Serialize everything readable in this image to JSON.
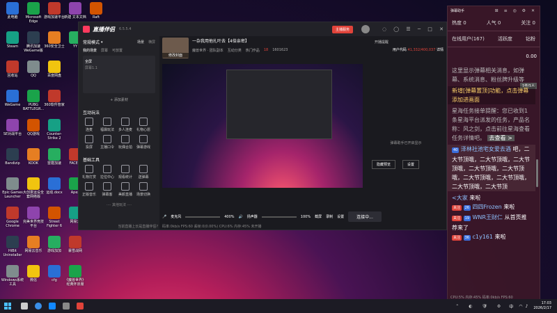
{
  "desktop": {
    "icons": [
      {
        "label": "此电脑"
      },
      {
        "label": "Microsoft Edge"
      },
      {
        "label": "游戏加速平台"
      },
      {
        "label": "新建 文本文档"
      },
      {
        "label": "Raft"
      },
      {
        "label": "Steam"
      },
      {
        "label": "腾讯加速 WeGame版"
      },
      {
        "label": "360安全卫士"
      },
      {
        "label": "YY"
      },
      {
        "label": "回收站"
      },
      {
        "label": "QQ"
      },
      {
        "label": "百度网盘"
      },
      {
        "label": "WeGame"
      },
      {
        "label": "PUBG BATTLEGR..."
      },
      {
        "label": "360软件管家"
      },
      {
        "label": "SE对战平台"
      },
      {
        "label": "QQ游戏"
      },
      {
        "label": "Counter-Strike 2"
      },
      {
        "label": "Bandizip"
      },
      {
        "label": "KOOK"
      },
      {
        "label": "雷霆加速"
      },
      {
        "label": "FACEIT"
      },
      {
        "label": "Epic Games Launcher"
      },
      {
        "label": "大创意运设全套网络版"
      },
      {
        "label": "运动.docx"
      },
      {
        "label": "Apex"
      },
      {
        "label": "Google Chrome"
      },
      {
        "label": "完美世界竞技平台"
      },
      {
        "label": "Street Fighter 6"
      },
      {
        "label": "网易云"
      },
      {
        "label": "HiBit Uninstaller"
      },
      {
        "label": "网易云音乐"
      },
      {
        "label": "游戏加加"
      },
      {
        "label": "暴雪战网"
      },
      {
        "label": "Windows系统工具"
      },
      {
        "label": "微信"
      },
      {
        "label": "cfg"
      },
      {
        "label": "《魔兽世界》经典怀旧服"
      }
    ]
  },
  "app": {
    "title": "直播伴侣",
    "version": "6.5.5.4",
    "header_btn": "主播服务",
    "left": {
      "mode": "常规模式",
      "mode_tabs": [
        "场景",
        "横屏"
      ],
      "scene_tabs": [
        "我的场景",
        "屏幕",
        "可放置"
      ],
      "scenes": [
        "全屏",
        "屏幕1.1"
      ],
      "add_material": "+ 添加素材",
      "interactive_title": "互动玩法",
      "interactive": [
        "连麦",
        "福袋玩法",
        "多人连麦",
        "礼物心愿",
        "投屏",
        "主播口令",
        "玩偶合拍",
        "弹幕游戏"
      ],
      "tools_title": "基础工具",
      "tools": [
        "礼物打赏",
        "拉位中心",
        "观看统计",
        "送弹幕",
        "正版音乐",
        "弹幕客",
        "美颜直播",
        "场景切换"
      ],
      "more": "···· 其他玩法 ····",
      "tip": "当前直播上长是直播伴侣?"
    },
    "main": {
      "stream_title": "一杂我用他扎叶去【4倍亲密】",
      "avatar_label": "修改封面",
      "category": "魔兽世界 · 团队副本",
      "tags": [
        "互动分类",
        "热门作品"
      ],
      "count_a": "18",
      "count_b": "1601623",
      "right_btn": "开播提醒",
      "side_title": "用户代码",
      "side_val": "41,332/400,037",
      "side_link": "详情",
      "preview_note": "弹幕助手已开启显示",
      "controls": {
        "mic_label": "麦克风",
        "mic_val": "400%",
        "spk_label": "扬声器",
        "spk_val": "100%",
        "effects": [
          "截屏",
          "录制",
          "设置"
        ],
        "start": "连接中..."
      },
      "status": "码率:0kb/s  FPS:60  丢帧:0(0.00%)  CPU:6%  内存:45%  未开播",
      "preview_buttons": [
        "隐藏预览",
        "设置"
      ]
    }
  },
  "danmu": {
    "title": "弹幕助手",
    "stats": [
      "热度 0",
      "人气 0",
      "关注 0"
    ],
    "tabs": [
      "在线用户(167)",
      "活跃度",
      "钻粉"
    ],
    "messages": [
      {
        "text": "这里显示弹幕相关消息，如弹幕、系统消息、粉丝牌升级等"
      },
      {
        "text": "新增[弹幕置顶]功能，点击弹幕添加进画面",
        "highlight": true
      },
      {
        "text": "星海任务接单提醒：您已收到1条星海平台派发的任务，产品名称：风之剑，点击前往星海查看任务详情吧。",
        "link": "去查看 >"
      },
      {
        "user": "泽林社池宅女爱去酒",
        "badge": "40",
        "content": "吧，二大节顶哦，二大节顶哦，二大节顶哦，二大节顶哦，二大节顶哦，二大节顶哦，二大节顶哦，二大节顶哦，二大节顶"
      },
      {
        "user": "<大家",
        "content": "来啦"
      },
      {
        "tag": "关注",
        "user": "四四Frozen",
        "badge": "26",
        "content": "来啦"
      },
      {
        "tag": "关注",
        "user": "WNR王财仁",
        "badge": "19",
        "content": "从首页推荐来了"
      },
      {
        "tag": "关注",
        "user": "c1y161",
        "badge": "36",
        "content": "来啦"
      }
    ],
    "gift_tag": "1件/1人",
    "amount": "0.00",
    "footer": "CPU:5%  内存:45%  码率:0kb/s  FPS:60"
  },
  "taskbar": {
    "time": "17:03",
    "date": "2026/2/17",
    "lang": "中"
  },
  "colors": {
    "accent": "#e0433a",
    "panel": "#222227",
    "danmu_bg": "#3c1828"
  }
}
